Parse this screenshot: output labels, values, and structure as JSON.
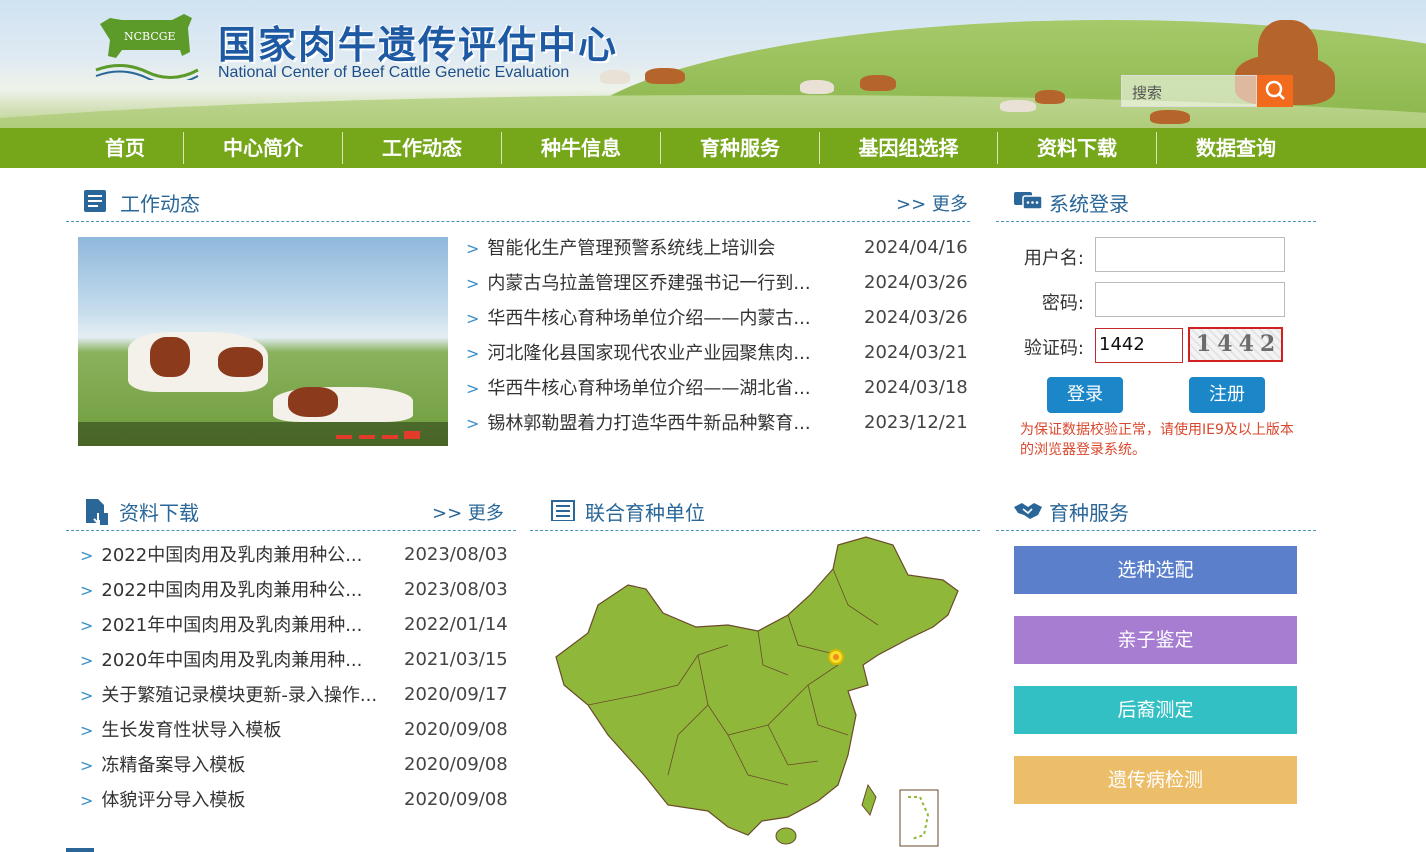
{
  "header": {
    "title": "国家肉牛遗传评估中心",
    "subtitle": "National Center of Beef Cattle Genetic Evaluation",
    "logo_text": "NCBCGE",
    "search_placeholder": "搜索"
  },
  "nav": [
    "首页",
    "中心简介",
    "工作动态",
    "种牛信息",
    "育种服务",
    "基因组选择",
    "资料下载",
    "数据查询"
  ],
  "work_news": {
    "title": "工作动态",
    "more": ">> 更多",
    "items": [
      {
        "title": "智能化生产管理预警系统线上培训会",
        "date": "2024/04/16"
      },
      {
        "title": "内蒙古乌拉盖管理区乔建强书记一行到...",
        "date": "2024/03/26"
      },
      {
        "title": "华西牛核心育种场单位介绍——内蒙古...",
        "date": "2024/03/26"
      },
      {
        "title": "河北隆化县国家现代农业产业园聚焦肉...",
        "date": "2024/03/21"
      },
      {
        "title": "华西牛核心育种场单位介绍——湖北省...",
        "date": "2024/03/18"
      },
      {
        "title": "锡林郭勒盟着力打造华西牛新品种繁育...",
        "date": "2023/12/21"
      }
    ]
  },
  "login": {
    "title": "系统登录",
    "username_label": "用户名:",
    "password_label": "密码:",
    "captcha_label": "验证码:",
    "captcha_value": "1442",
    "captcha_image_text": "1442",
    "login_button": "登录",
    "register_button": "注册",
    "note": "为保证数据校验正常，请使用IE9及以上版本的浏览器登录系统。"
  },
  "downloads": {
    "title": "资料下载",
    "more": ">> 更多",
    "items": [
      {
        "title": "2022中国肉用及乳肉兼用种公...",
        "date": "2023/08/03"
      },
      {
        "title": "2022中国肉用及乳肉兼用种公...",
        "date": "2023/08/03"
      },
      {
        "title": "2021年中国肉用及乳肉兼用种...",
        "date": "2022/01/14"
      },
      {
        "title": "2020年中国肉用及乳肉兼用种...",
        "date": "2021/03/15"
      },
      {
        "title": "关于繁殖记录模块更新-录入操作...",
        "date": "2020/09/17"
      },
      {
        "title": "生长发育性状导入模板",
        "date": "2020/09/08"
      },
      {
        "title": "冻精备案导入模板",
        "date": "2020/09/08"
      },
      {
        "title": "体貌评分导入模板",
        "date": "2020/09/08"
      }
    ]
  },
  "joint_units": {
    "title": "联合育种单位"
  },
  "breeding_service": {
    "title": "育种服务",
    "buttons": [
      {
        "label": "选种选配",
        "color": "#5b7fcb"
      },
      {
        "label": "亲子鉴定",
        "color": "#a77dd1"
      },
      {
        "label": "后裔测定",
        "color": "#33c0c4"
      },
      {
        "label": "遗传病检测",
        "color": "#ecbe6a"
      }
    ]
  }
}
